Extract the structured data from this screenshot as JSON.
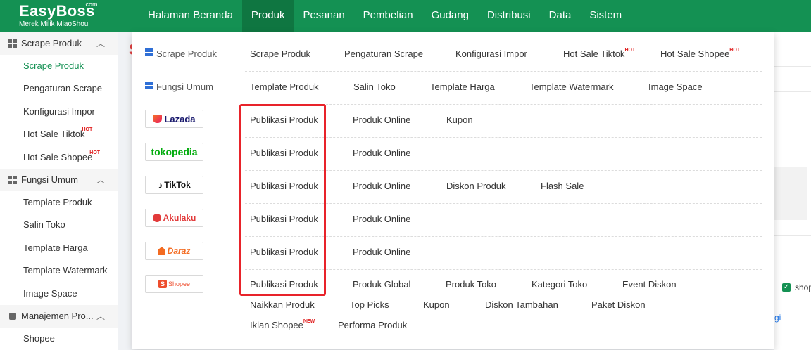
{
  "logo": {
    "name": "EasyBoss",
    "com": ".com",
    "subtitle": "Merek Milik MiaoShou"
  },
  "nav": [
    {
      "label": "Halaman Beranda"
    },
    {
      "label": "Produk",
      "active": true
    },
    {
      "label": "Pesanan"
    },
    {
      "label": "Pembelian"
    },
    {
      "label": "Gudang"
    },
    {
      "label": "Distribusi"
    },
    {
      "label": "Data"
    },
    {
      "label": "Sistem"
    }
  ],
  "sidebar": {
    "groups": [
      {
        "label": "Scrape Produk",
        "items": [
          "Scrape Produk",
          "Pengaturan Scrape",
          "Konfigurasi Impor",
          "Hot Sale Tiktok",
          "Hot Sale Shopee"
        ]
      },
      {
        "label": "Fungsi Umum",
        "items": [
          "Template Produk",
          "Salin Toko",
          "Template Harga",
          "Template Watermark",
          "Image Space"
        ]
      },
      {
        "label": "Manajemen Pro...",
        "items": [
          "Shopee"
        ]
      }
    ],
    "hot_badge": "HOT"
  },
  "background": {
    "letter": "S",
    "shop_label": "shop",
    "link_fragment": "gi"
  },
  "menu": {
    "hot_badge": "HOT",
    "new_badge": "NEW",
    "scrape": {
      "label": "Scrape Produk",
      "links": [
        "Scrape Produk",
        "Pengaturan Scrape",
        "Konfigurasi Impor",
        "Hot Sale Tiktok",
        "Hot Sale Shopee"
      ]
    },
    "umum": {
      "label": "Fungsi Umum",
      "links": [
        "Template Produk",
        "Salin Toko",
        "Template Harga",
        "Template Watermark",
        "Image Space"
      ]
    },
    "lazada": {
      "brand": "Lazada",
      "links": [
        "Publikasi Produk",
        "Produk Online",
        "Kupon"
      ]
    },
    "tokopedia": {
      "brand": "tokopedia",
      "links": [
        "Publikasi Produk",
        "Produk Online"
      ]
    },
    "tiktok": {
      "brand": "TikTok",
      "links": [
        "Publikasi Produk",
        "Produk Online",
        "Diskon Produk",
        "Flash Sale"
      ]
    },
    "akulaku": {
      "brand": "Akulaku",
      "links": [
        "Publikasi Produk",
        "Produk Online"
      ]
    },
    "daraz": {
      "brand": "Daraz",
      "links": [
        "Publikasi Produk",
        "Produk Online"
      ]
    },
    "shopee": {
      "brand": "Shopee",
      "links": [
        "Publikasi Produk",
        "Produk Global",
        "Produk Toko",
        "Kategori Toko",
        "Event Diskon"
      ],
      "links2": [
        "Naikkan Produk",
        "Top Picks",
        "Kupon",
        "Diskon Tambahan",
        "Paket Diskon"
      ],
      "links3": [
        "Iklan Shopee",
        "Performa Produk"
      ]
    }
  },
  "colors": {
    "brand_green": "#149153",
    "highlight_red": "#e8232a"
  }
}
